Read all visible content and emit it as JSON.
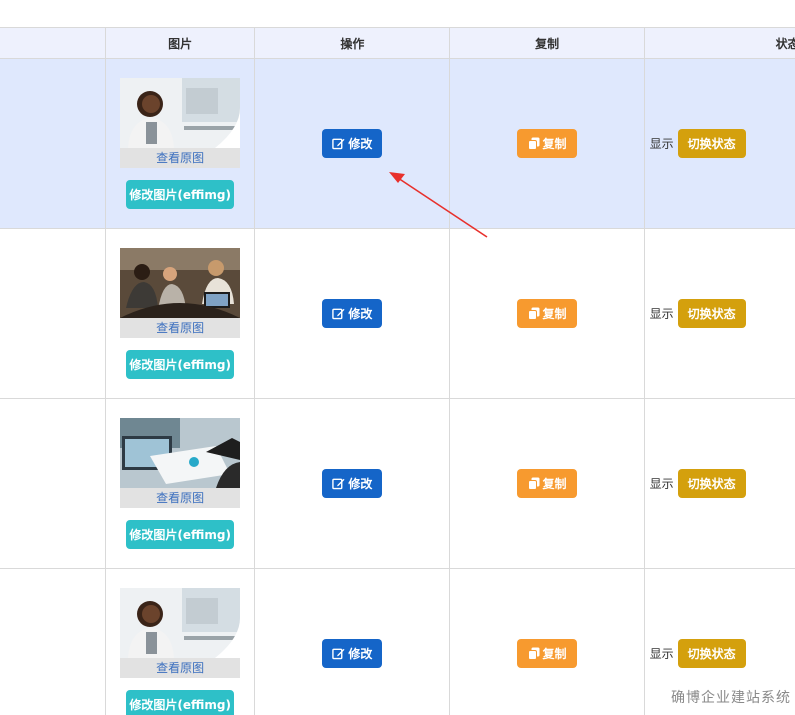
{
  "table": {
    "headers": {
      "image": "图片",
      "operation": "操作",
      "copy": "复制",
      "status": "状态"
    },
    "rows": [
      {
        "highlighted": true,
        "thumbnail": "woman-at-desk-photo",
        "view_original": "查看原图",
        "edit_image_label": "修改图片(effimg)",
        "edit_label": "修改",
        "copy_label": "复制",
        "status_text": "显示",
        "toggle_label": "切换状态"
      },
      {
        "highlighted": false,
        "thumbnail": "team-meeting-laptop-photo",
        "view_original": "查看原图",
        "edit_image_label": "修改图片(effimg)",
        "edit_label": "修改",
        "copy_label": "复制",
        "status_text": "显示",
        "toggle_label": "切换状态"
      },
      {
        "highlighted": false,
        "thumbnail": "documents-laptop-photo",
        "view_original": "查看原图",
        "edit_image_label": "修改图片(effimg)",
        "edit_label": "修改",
        "copy_label": "复制",
        "status_text": "显示",
        "toggle_label": "切换状态"
      },
      {
        "highlighted": false,
        "thumbnail": "woman-at-desk-photo",
        "view_original": "查看原图",
        "edit_image_label": "修改图片(effimg)",
        "edit_label": "修改",
        "copy_label": "复制",
        "status_text": "显示",
        "toggle_label": "切换状态"
      }
    ]
  },
  "watermark": "确博企业建站系统",
  "colors": {
    "header_bg": "#eef1fd",
    "highlight_row_bg": "#dfe8fd",
    "edit_button": "#1565c8",
    "copy_button": "#f79a2f",
    "toggle_button": "#d4a00d",
    "effimg_button": "#2ec0c8",
    "arrow": "#e8302c"
  },
  "icons": {
    "edit": "pencil-square-icon",
    "copy": "copy-icon",
    "annotation": "red-arrow-pointer"
  }
}
